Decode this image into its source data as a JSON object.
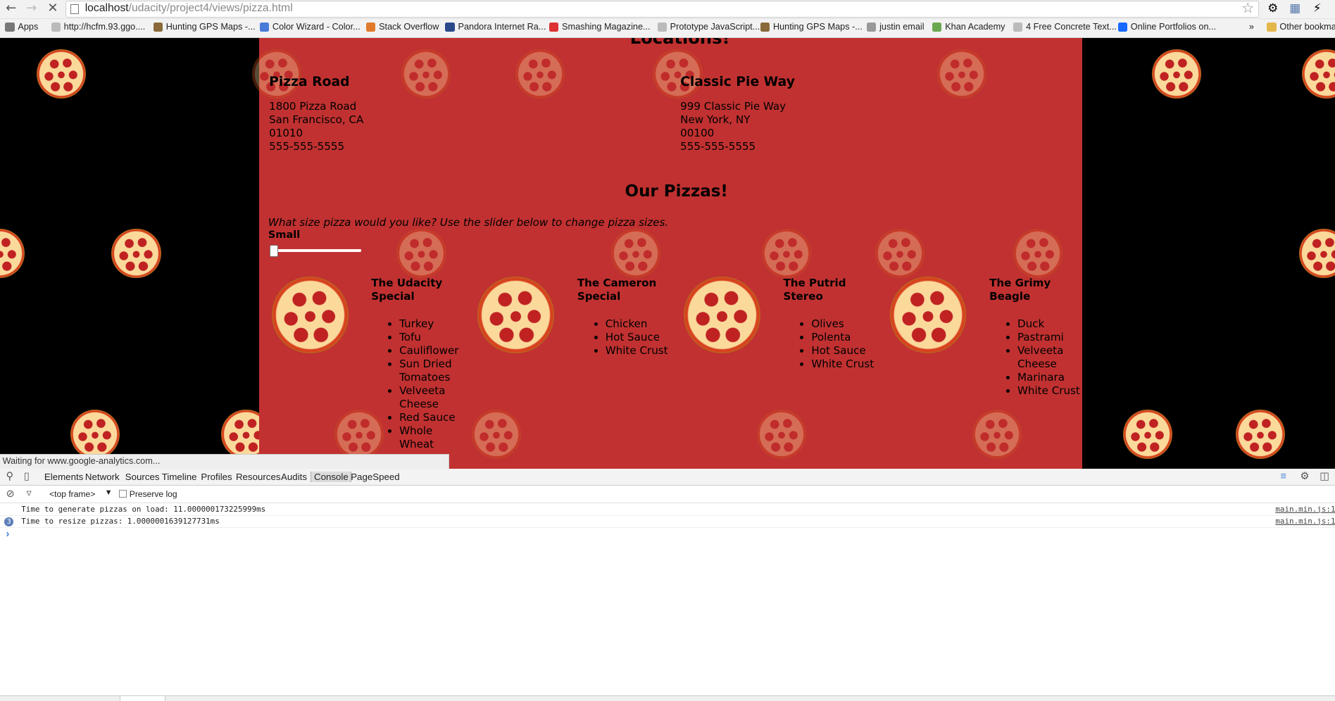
{
  "browser": {
    "url_host": "localhost",
    "url_path": "/udacity/project4/views/pizza.html",
    "status_text": "Waiting for www.google-analytics.com...",
    "bookmarks": [
      {
        "label": "Apps",
        "icon": "apps-grid-icon"
      },
      {
        "label": "http://hcfm.93.ggo....",
        "icon": "page-icon"
      },
      {
        "label": "Hunting GPS Maps -...",
        "icon": "antler-icon"
      },
      {
        "label": "Color Wizard - Color...",
        "icon": "google-icon"
      },
      {
        "label": "Stack Overflow",
        "icon": "stackoverflow-icon"
      },
      {
        "label": "Pandora Internet Ra...",
        "icon": "pandora-icon"
      },
      {
        "label": "Smashing Magazine...",
        "icon": "smashing-icon"
      },
      {
        "label": "Prototype JavaScript...",
        "icon": "page-icon"
      },
      {
        "label": "Hunting GPS Maps -...",
        "icon": "antler-icon"
      },
      {
        "label": "justin email",
        "icon": "email-icon"
      },
      {
        "label": "Khan Academy",
        "icon": "khan-leaf-icon"
      },
      {
        "label": "4 Free Concrete Text...",
        "icon": "page-icon"
      },
      {
        "label": "Online Portfolios on...",
        "icon": "behance-icon"
      }
    ],
    "overflow_label": "»",
    "other_bookmarks": "Other bookma"
  },
  "page": {
    "locations_heading": "Locations!",
    "stores": [
      {
        "name": "Pizza Road",
        "lines": [
          "1800 Pizza Road",
          "San Francisco, CA",
          "01010",
          "555-555-5555"
        ]
      },
      {
        "name": "Classic Pie Way",
        "lines": [
          "999 Classic Pie Way",
          "New York, NY",
          "00100",
          "555-555-5555"
        ]
      }
    ],
    "pizzas_heading": "Our Pizzas!",
    "size_question": "What size pizza would you like? Use the slider below to change pizza sizes.",
    "size_label": "Small",
    "pizzas": [
      {
        "name": "The Udacity Special",
        "toppings": [
          "Turkey",
          "Tofu",
          "Cauliflower",
          "Sun Dried Tomatoes",
          "Velveeta Cheese",
          "Red Sauce",
          "Whole Wheat"
        ]
      },
      {
        "name": "The Cameron Special",
        "toppings": [
          "Chicken",
          "Hot Sauce",
          "White Crust"
        ]
      },
      {
        "name": "The Putrid Stereo",
        "toppings": [
          "Olives",
          "Polenta",
          "Hot Sauce",
          "White Crust"
        ]
      },
      {
        "name": "The Grimy Beagle",
        "toppings": [
          "Duck",
          "Pastrami",
          "Velveeta Cheese",
          "Marinara",
          "White Crust"
        ]
      }
    ]
  },
  "devtools": {
    "tabs": [
      "Elements",
      "Network",
      "Sources",
      "Timeline",
      "Profiles",
      "Resources",
      "Audits",
      "Console",
      "PageSpeed"
    ],
    "active_tab": "Console",
    "frame_selector": "<top frame>",
    "preserve_log": "Preserve log",
    "console": [
      {
        "text": "Time to generate pizzas on load: 11.000000173225999ms",
        "source": "main.min.js:1",
        "badge": ""
      },
      {
        "text": "Time to resize pizzas: 1.0000001639127731ms",
        "source": "main.min.js:1",
        "badge": "3"
      }
    ],
    "prompt": "›"
  }
}
